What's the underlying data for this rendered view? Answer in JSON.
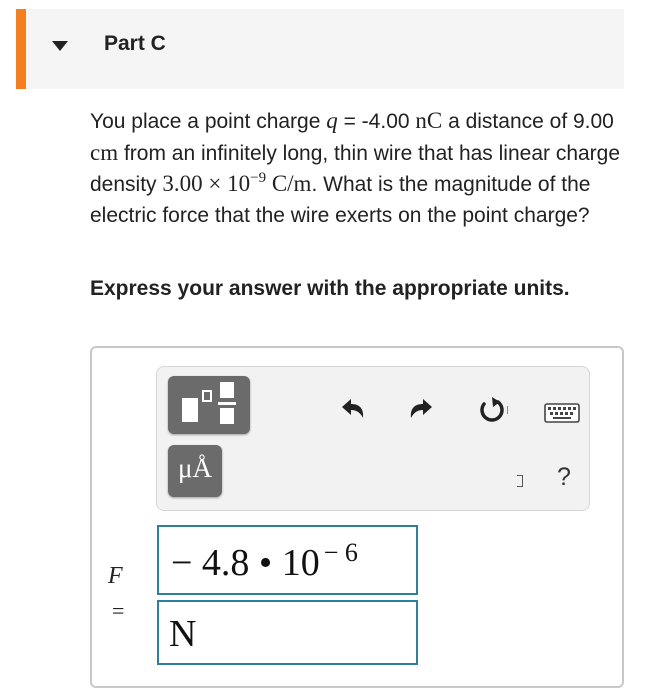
{
  "part": {
    "title": "Part C"
  },
  "question": {
    "t1": "You place a point charge ",
    "q_symbol": "q",
    "t2": " = -4.00 ",
    "q_unit": "nC",
    "t3": " a distance of 9.00 ",
    "d_unit": "cm",
    "t4": " from an infinitely long, thin wire that has linear charge density ",
    "lambda_mantissa": "3.00 × 10",
    "lambda_exponent": "−9",
    "lambda_unit": " C/m",
    "t5": ". What is the magnitude of the electric force that the wire exerts on the point charge?"
  },
  "instruction": "Express your answer with the appropriate units.",
  "toolbar": {
    "units_button_label": "μÅ",
    "icons": [
      "templates-icon",
      "units-icon",
      "undo-icon",
      "redo-icon",
      "reset-icon",
      "keyboard-icon",
      "help-icon"
    ],
    "help_label": "?"
  },
  "answer": {
    "variable": "F",
    "equals": "=",
    "value_text": "− 4.8 • 10",
    "value_exponent": "− 6",
    "unit": "N"
  },
  "colors": {
    "accent": "#f47f20",
    "field_border": "#2f7e9e",
    "header_bg": "#f5f5f5"
  }
}
